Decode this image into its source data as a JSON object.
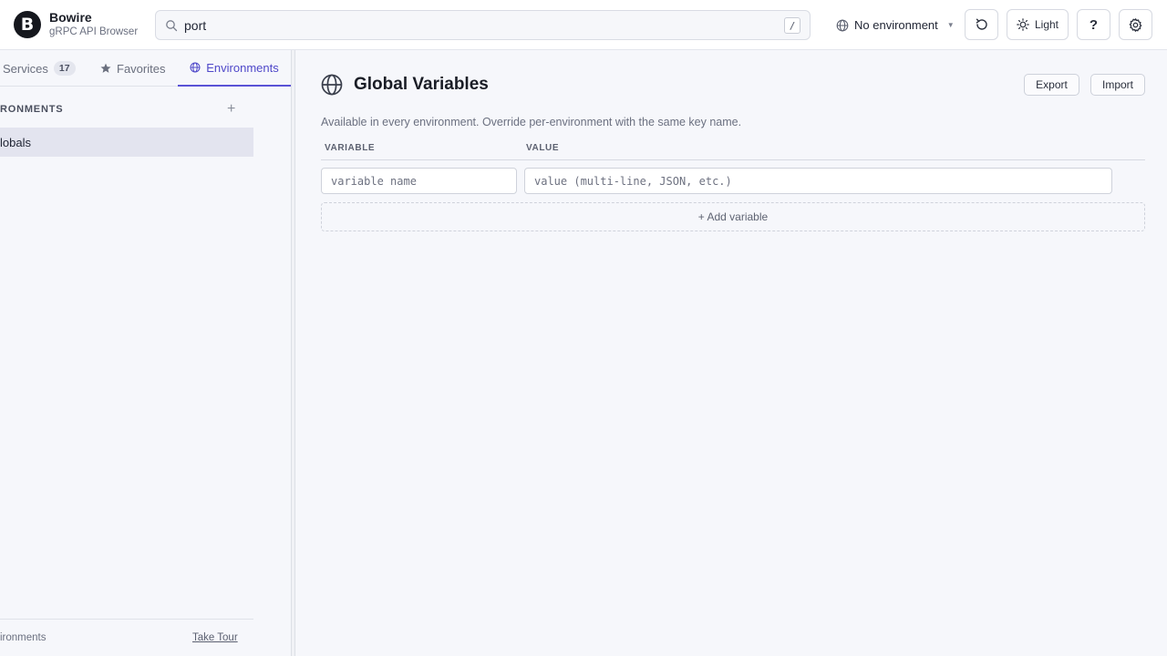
{
  "app": {
    "logo_letter": "B",
    "title": "Bowire",
    "subtitle": "gRPC API Browser"
  },
  "search": {
    "value": "port",
    "shortcut": "/"
  },
  "environment_selector": {
    "label": "No environment"
  },
  "toolbar": {
    "theme_label": "Light",
    "help_label": "?"
  },
  "sidebar": {
    "tabs": [
      {
        "label": "Services",
        "count": "17"
      },
      {
        "label": "Favorites"
      },
      {
        "label": "Environments"
      }
    ],
    "section_label": "RONMENTS",
    "add_symbol": "+",
    "items": [
      {
        "label": "lobals"
      }
    ],
    "footer": {
      "left_text": "ironments",
      "tour_label": "Take Tour"
    }
  },
  "main": {
    "title": "Global Variables",
    "export_label": "Export",
    "import_label": "Import",
    "description": "Available in every environment. Override per-environment with the same key name.",
    "columns": {
      "variable": "VARIABLE",
      "value": "VALUE"
    },
    "variable_placeholder": "variable name",
    "value_placeholder": "value (multi-line, JSON, etc.)",
    "add_variable_label": "+ Add variable"
  },
  "colors": {
    "accent": "#5a52d6",
    "selected_bg": "#e3e4ef"
  }
}
